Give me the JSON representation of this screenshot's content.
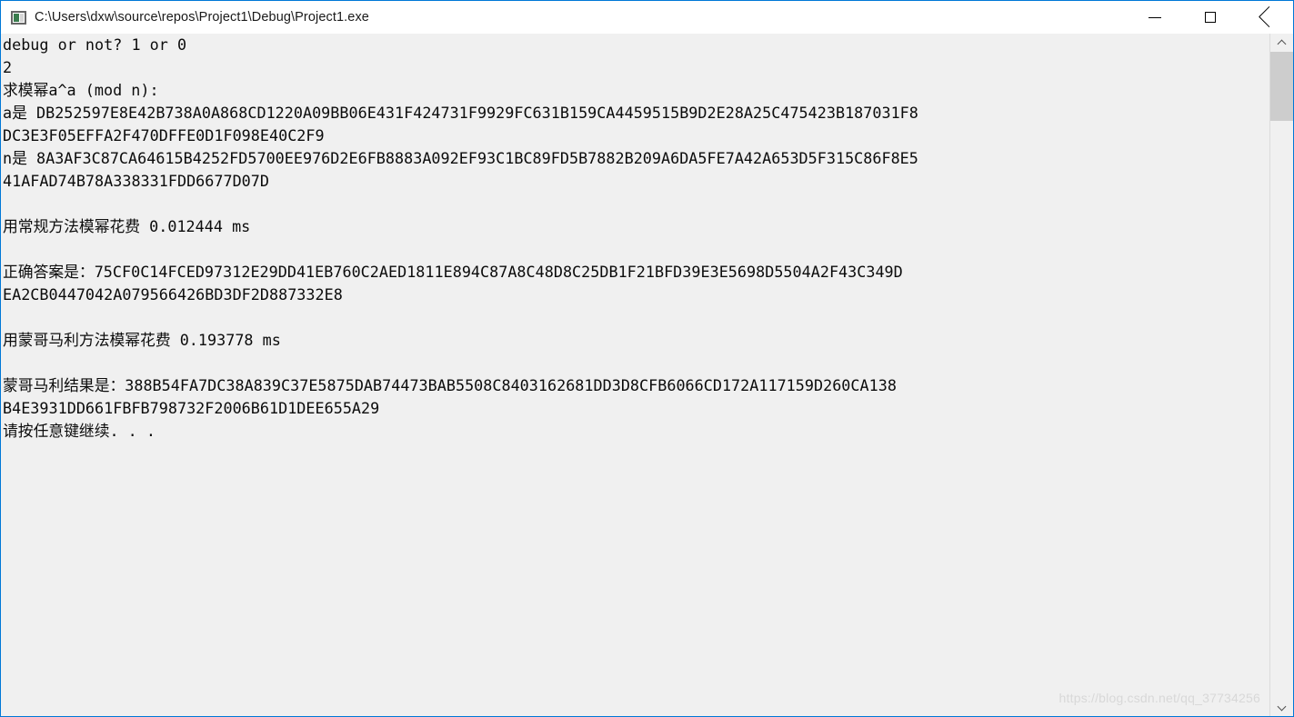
{
  "window": {
    "title": "C:\\Users\\dxw\\source\\repos\\Project1\\Debug\\Project1.exe",
    "icon": "console-app-icon",
    "controls": {
      "minimize": "minimize",
      "maximize": "maximize",
      "close": "close"
    },
    "accent_color": "#0078d7",
    "titlebar_background": "#ffffff",
    "console_background": "#f0f0f0",
    "console_foreground": "#0c0c0c"
  },
  "console": {
    "lines": [
      "debug or not? 1 or 0",
      "2",
      "求模幂a^a (mod n):",
      "a是 DB252597E8E42B738A0A868CD1220A09BB06E431F424731F9929FC631B159CA4459515B9D2E28A25C475423B187031F8",
      "DC3E3F05EFFA2F470DFFE0D1F098E40C2F9",
      "n是 8A3AF3C87CA64615B4252FD5700EE976D2E6FB8883A092EF93C1BC89FD5B7882B209A6DA5FE7A42A653D5F315C86F8E5",
      "41AFAD74B78A338331FDD6677D07D",
      "",
      "用常规方法模幂花费 0.012444 ms",
      "",
      "正确答案是：75CF0C14FCED97312E29DD41EB760C2AED1811E894C87A8C48D8C25DB1F21BFD39E3E5698D5504A2F43C349D",
      "EA2CB0447042A079566426BD3DF2D887332E8",
      "",
      "用蒙哥马利方法模幂花费 0.193778 ms",
      "",
      "蒙哥马利结果是：388B54FA7DC38A839C37E5875DAB74473BAB5508C8403162681DD3D8CFB6066CD172A117159D260CA138",
      "B4E3931DD661FBFB798732F2006B61D1DEE655A29",
      "请按任意键继续. . ."
    ],
    "prompt": "debug or not? 1 or 0",
    "user_input": "2",
    "task_label": "求模幂a^a (mod n):",
    "value_a_label": "a是",
    "value_a": "DB252597E8E42B738A0A868CD1220A09BB06E431F424731F9929FC631B159CA4459515B9D2E28A25C475423B187031F8DC3E3F05EFFA2F470DFFE0D1F098E40C2F9",
    "value_n_label": "n是",
    "value_n": "8A3AF3C87CA64615B4252FD5700EE976D2E6FB8883A092EF93C1BC89FD5B7882B209A6DA5FE7A42A653D5F315C86F8E541AFAD74B78A338331FDD6677D07D",
    "standard_time_label": "用常规方法模幂花费",
    "standard_time_value": "0.012444",
    "standard_time_unit": "ms",
    "correct_answer_label": "正确答案是：",
    "correct_answer": "75CF0C14FCED97312E29DD41EB760C2AED1811E894C87A8C48D8C25DB1F21BFD39E3E5698D5504A2F43C349DEA2CB0447042A079566426BD3DF2D887332E8",
    "montgomery_time_label": "用蒙哥马利方法模幂花费",
    "montgomery_time_value": "0.193778",
    "montgomery_time_unit": "ms",
    "montgomery_result_label": "蒙哥马利结果是：",
    "montgomery_result": "388B54FA7DC38A839C37E5875DAB74473BAB5508C8403162681DD3D8CFB6066CD172A117159D260CA138B4E3931DD661FBFB798732F2006B61D1DEE655A29",
    "footer": "请按任意键继续. . ."
  },
  "scrollbar": {
    "up_arrow_icon": "chevron-up-icon",
    "down_arrow_icon": "chevron-down-icon",
    "thumb_position": "top"
  },
  "watermark": {
    "text": "https://blog.csdn.net/qq_37734256"
  }
}
